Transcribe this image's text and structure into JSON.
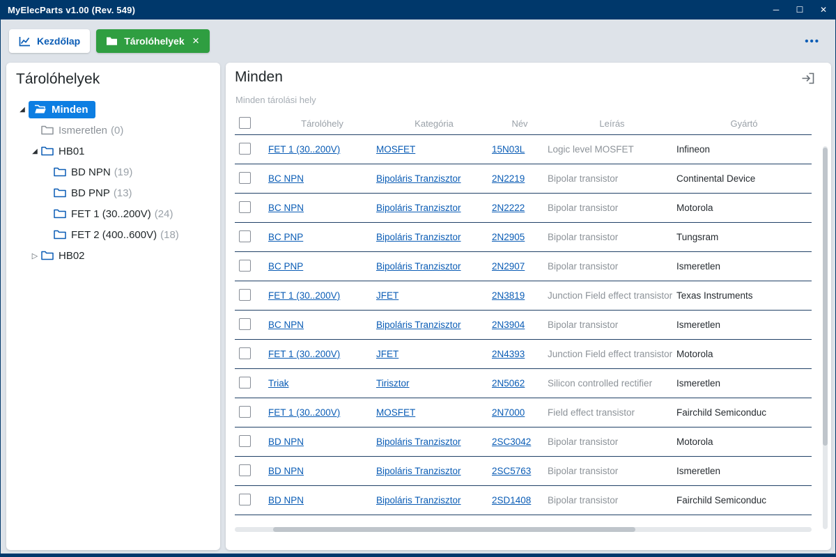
{
  "titlebar": {
    "title": "MyElecParts v1.00  (Rev. 549)",
    "minimize": "─",
    "maximize": "☐",
    "close": "✕"
  },
  "tabbar": {
    "tabs": [
      {
        "label": "Kezdőlap"
      },
      {
        "label": "Tárolóhelyek",
        "close": "✕"
      }
    ],
    "overflow": "•••"
  },
  "sidebar": {
    "title": "Tárolóhelyek",
    "tree": [
      {
        "label": "Minden",
        "count": "",
        "expanded": true,
        "selected": true
      },
      {
        "label": "Ismeretlen",
        "count": "(0)"
      },
      {
        "label": "HB01",
        "count": "",
        "expanded": true
      },
      {
        "label": "BD NPN",
        "count": "(19)"
      },
      {
        "label": "BD PNP",
        "count": "(13)"
      },
      {
        "label": "FET 1 (30..200V)",
        "count": "(24)"
      },
      {
        "label": "FET 2 (400..600V)",
        "count": "(18)"
      },
      {
        "label": "HB02",
        "count": "",
        "expanded": false
      }
    ]
  },
  "main": {
    "title": "Minden",
    "subtitle": "Minden tárolási hely",
    "table": {
      "headers": [
        "Tárolóhely",
        "Kategória",
        "Név",
        "Leírás",
        "Gyártó"
      ],
      "rows": [
        {
          "storage": "FET 1 (30..200V)",
          "category": "MOSFET",
          "name": "15N03L",
          "desc": "Logic level MOSFET",
          "manu": "Infineon"
        },
        {
          "storage": "BC NPN",
          "category": "Bipoláris Tranzisztor",
          "name": "2N2219",
          "desc": "Bipolar transistor",
          "manu": "Continental Device"
        },
        {
          "storage": "BC NPN",
          "category": "Bipoláris Tranzisztor",
          "name": "2N2222",
          "desc": "Bipolar transistor",
          "manu": "Motorola"
        },
        {
          "storage": "BC PNP",
          "category": "Bipoláris Tranzisztor",
          "name": "2N2905",
          "desc": "Bipolar transistor",
          "manu": "Tungsram"
        },
        {
          "storage": "BC PNP",
          "category": "Bipoláris Tranzisztor",
          "name": "2N2907",
          "desc": "Bipolar transistor",
          "manu": "Ismeretlen"
        },
        {
          "storage": "FET 1 (30..200V)",
          "category": "JFET",
          "name": "2N3819",
          "desc": "Junction Field effect transistor",
          "manu": "Texas Instruments"
        },
        {
          "storage": "BC NPN",
          "category": "Bipoláris Tranzisztor",
          "name": "2N3904",
          "desc": "Bipolar transistor",
          "manu": "Ismeretlen"
        },
        {
          "storage": "FET 1 (30..200V)",
          "category": "JFET",
          "name": "2N4393",
          "desc": "Junction Field effect transistor",
          "manu": "Motorola"
        },
        {
          "storage": "Triak",
          "category": "Tirisztor",
          "name": "2N5062",
          "desc": "Silicon controlled rectifier",
          "manu": "Ismeretlen"
        },
        {
          "storage": "FET 1 (30..200V)",
          "category": "MOSFET",
          "name": "2N7000",
          "desc": "Field effect transistor",
          "manu": "Fairchild Semiconduc"
        },
        {
          "storage": "BD NPN",
          "category": "Bipoláris Tranzisztor",
          "name": "2SC3042",
          "desc": "Bipolar transistor",
          "manu": "Motorola"
        },
        {
          "storage": "BD NPN",
          "category": "Bipoláris Tranzisztor",
          "name": "2SC5763",
          "desc": "Bipolar transistor",
          "manu": "Ismeretlen"
        },
        {
          "storage": "BD NPN",
          "category": "Bipoláris Tranzisztor",
          "name": "2SD1408",
          "desc": "Bipolar transistor",
          "manu": "Fairchild Semiconduc"
        }
      ]
    }
  },
  "colors": {
    "titlebar_navy": "#00386b",
    "tab_green": "#2f9e41",
    "accent_blue": "#0a5cb5",
    "selection_blue": "#0d7ee2",
    "row_border_navy": "#1f4066",
    "muted_gray": "#9aa1a8"
  }
}
